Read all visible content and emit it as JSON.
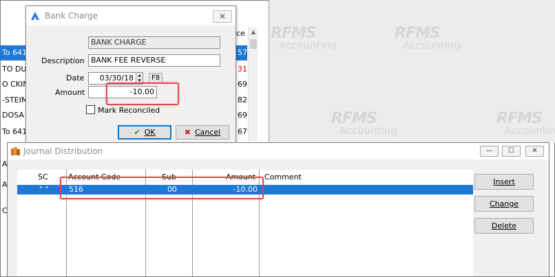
{
  "background_window": {
    "column_header_fragment": "ce",
    "rows": [
      {
        "text": "To 641",
        "value": "57",
        "selected": true,
        "value_red": false
      },
      {
        "text": "TO DU",
        "value": "31",
        "selected": false,
        "value_red": true
      },
      {
        "text": "O CKIN",
        "value": "69",
        "selected": false,
        "value_red": false
      },
      {
        "text": "-STEIM",
        "value": "82",
        "selected": false,
        "value_red": false
      },
      {
        "text": "DOSA",
        "value": "69",
        "selected": false,
        "value_red": false
      },
      {
        "text": "To 641",
        "value": "67",
        "selected": false,
        "value_red": false
      }
    ],
    "left_edge_fragments": [
      "A",
      "A",
      "C"
    ]
  },
  "watermark": {
    "logo_text": "RFMS",
    "sub_text": "Accounting"
  },
  "bank_charge_dialog": {
    "title": "Bank Charge",
    "close_glyph": "✕",
    "type_value": "BANK CHARGE",
    "description_label": "Description",
    "description_value": "BANK FEE REVERSE",
    "date_label": "Date",
    "date_value": "03/30/18",
    "date_lookup_key": "F8",
    "amount_label": "Amount",
    "amount_value": "-10.00",
    "mark_reconciled_label": "Mark Reconciled",
    "mark_reconciled_checked": false,
    "ok_label": "OK",
    "ok_hotkey": "O",
    "cancel_label": "Cancel",
    "cancel_hotkey": "C"
  },
  "journal_distribution": {
    "title": "Journal Distribution",
    "window_buttons": {
      "minimize": "—",
      "maximize": "☐",
      "close": "✕"
    },
    "columns": [
      "SC",
      "Account Code",
      "Sub",
      "Amount",
      "Comment"
    ],
    "rows": [
      {
        "sc": "\" \"",
        "account_code": "516",
        "sub": "00",
        "amount": "-10.00",
        "comment": ""
      }
    ],
    "buttons": {
      "insert": "Insert",
      "change": "Change",
      "delete": "Delete"
    }
  },
  "colors": {
    "selection": "#1e78d6",
    "highlight_box": "#e64646",
    "dialog_bg": "#f0f0f0"
  }
}
